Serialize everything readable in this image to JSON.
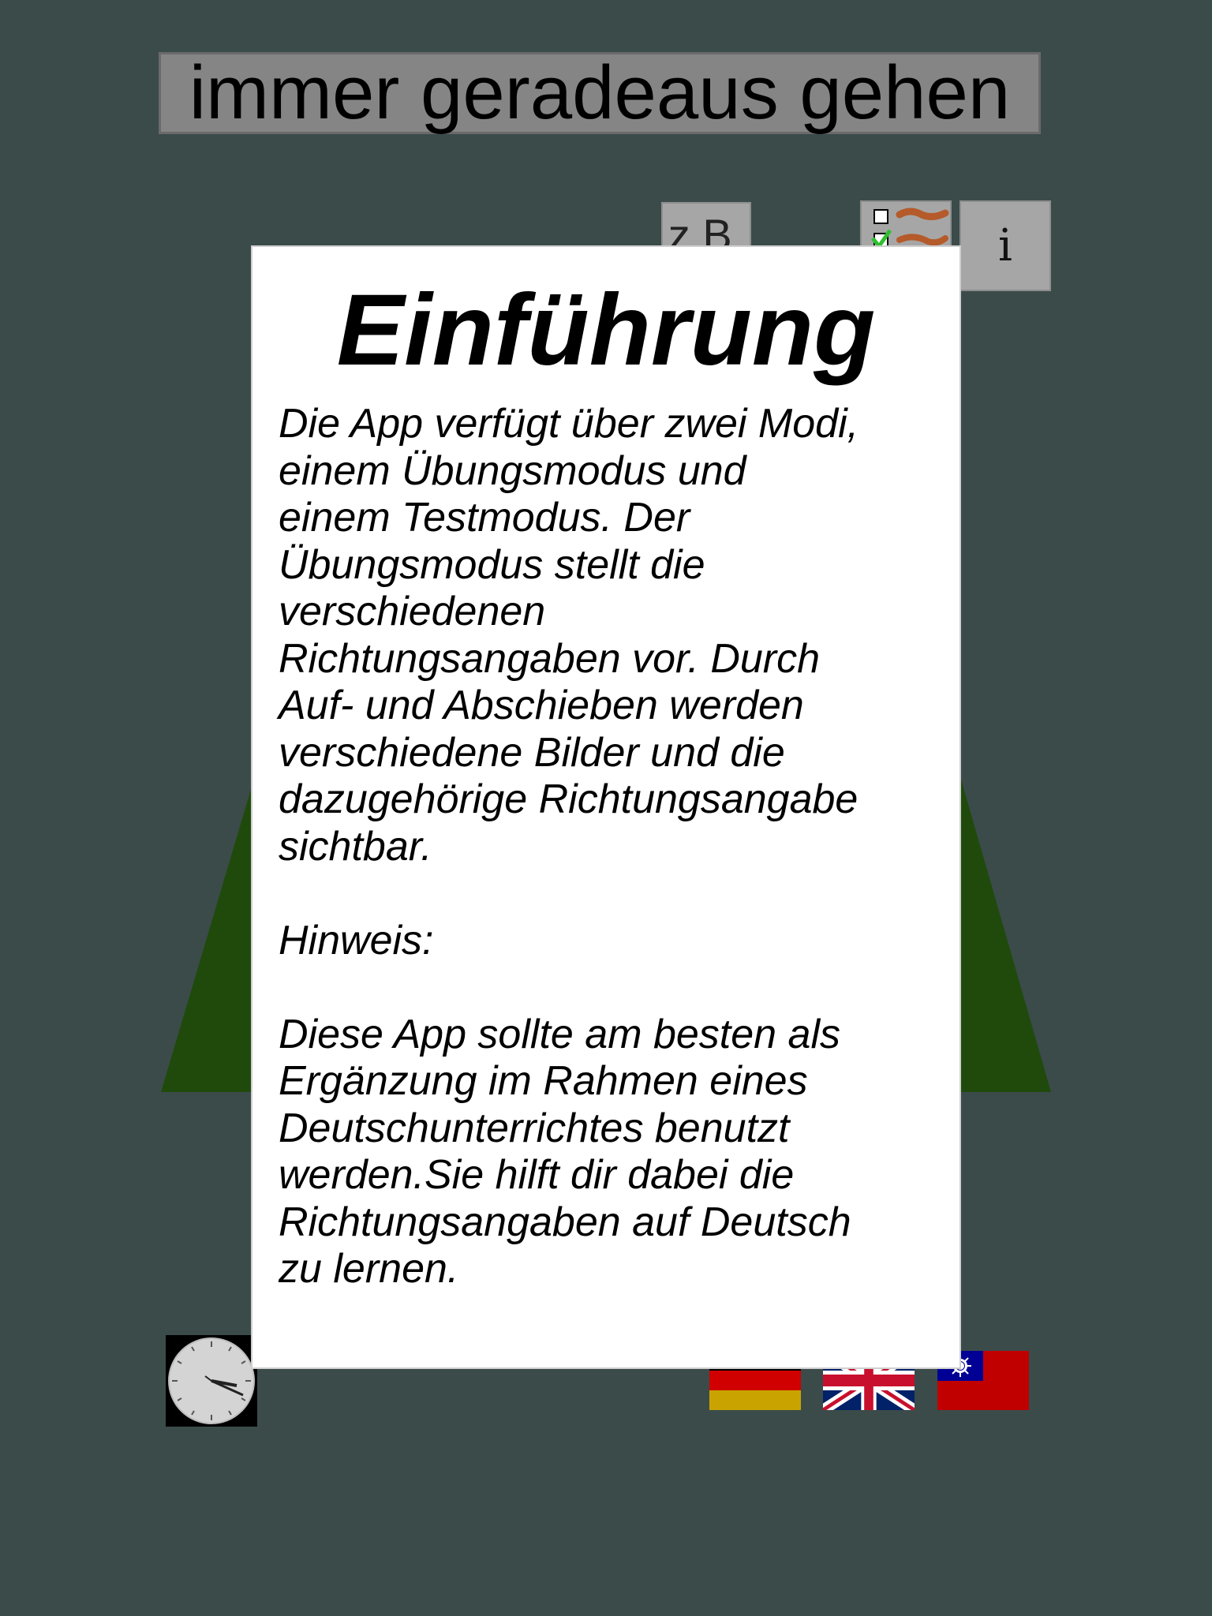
{
  "header": {
    "phrase": "immer geradeaus gehen"
  },
  "toolbar": {
    "example_label": "z.B.",
    "checklist_icon": "checklist-icon",
    "info_label": "i"
  },
  "scene": {
    "road_color": "#1f4a0c"
  },
  "modal": {
    "heading": "Einführung",
    "body_1": "Die App verfügt über zwei Modi,\neinem Übungsmodus und\neinem Testmodus. Der\nÜbungsmodus stellt die\nverschiedenen\nRichtungsangaben vor. Durch\nAuf- und Abschieben werden\nverschiedene Bilder und die\ndazugehörige Richtungsangabe\nsichtbar.\n\nHinweis:\n\nDiese App sollte am besten als\nErgänzung im Rahmen eines\nDeutschunterrichtes benutzt\nwerden.Sie hilft dir dabei die\nRichtungsangaben auf Deutsch\nzu lernen."
  },
  "footer": {
    "clock_icon": "clock-icon",
    "languages": [
      {
        "flag": "german-flag-icon"
      },
      {
        "flag": "uk-flag-icon"
      },
      {
        "flag": "taiwan-flag-icon"
      }
    ]
  }
}
